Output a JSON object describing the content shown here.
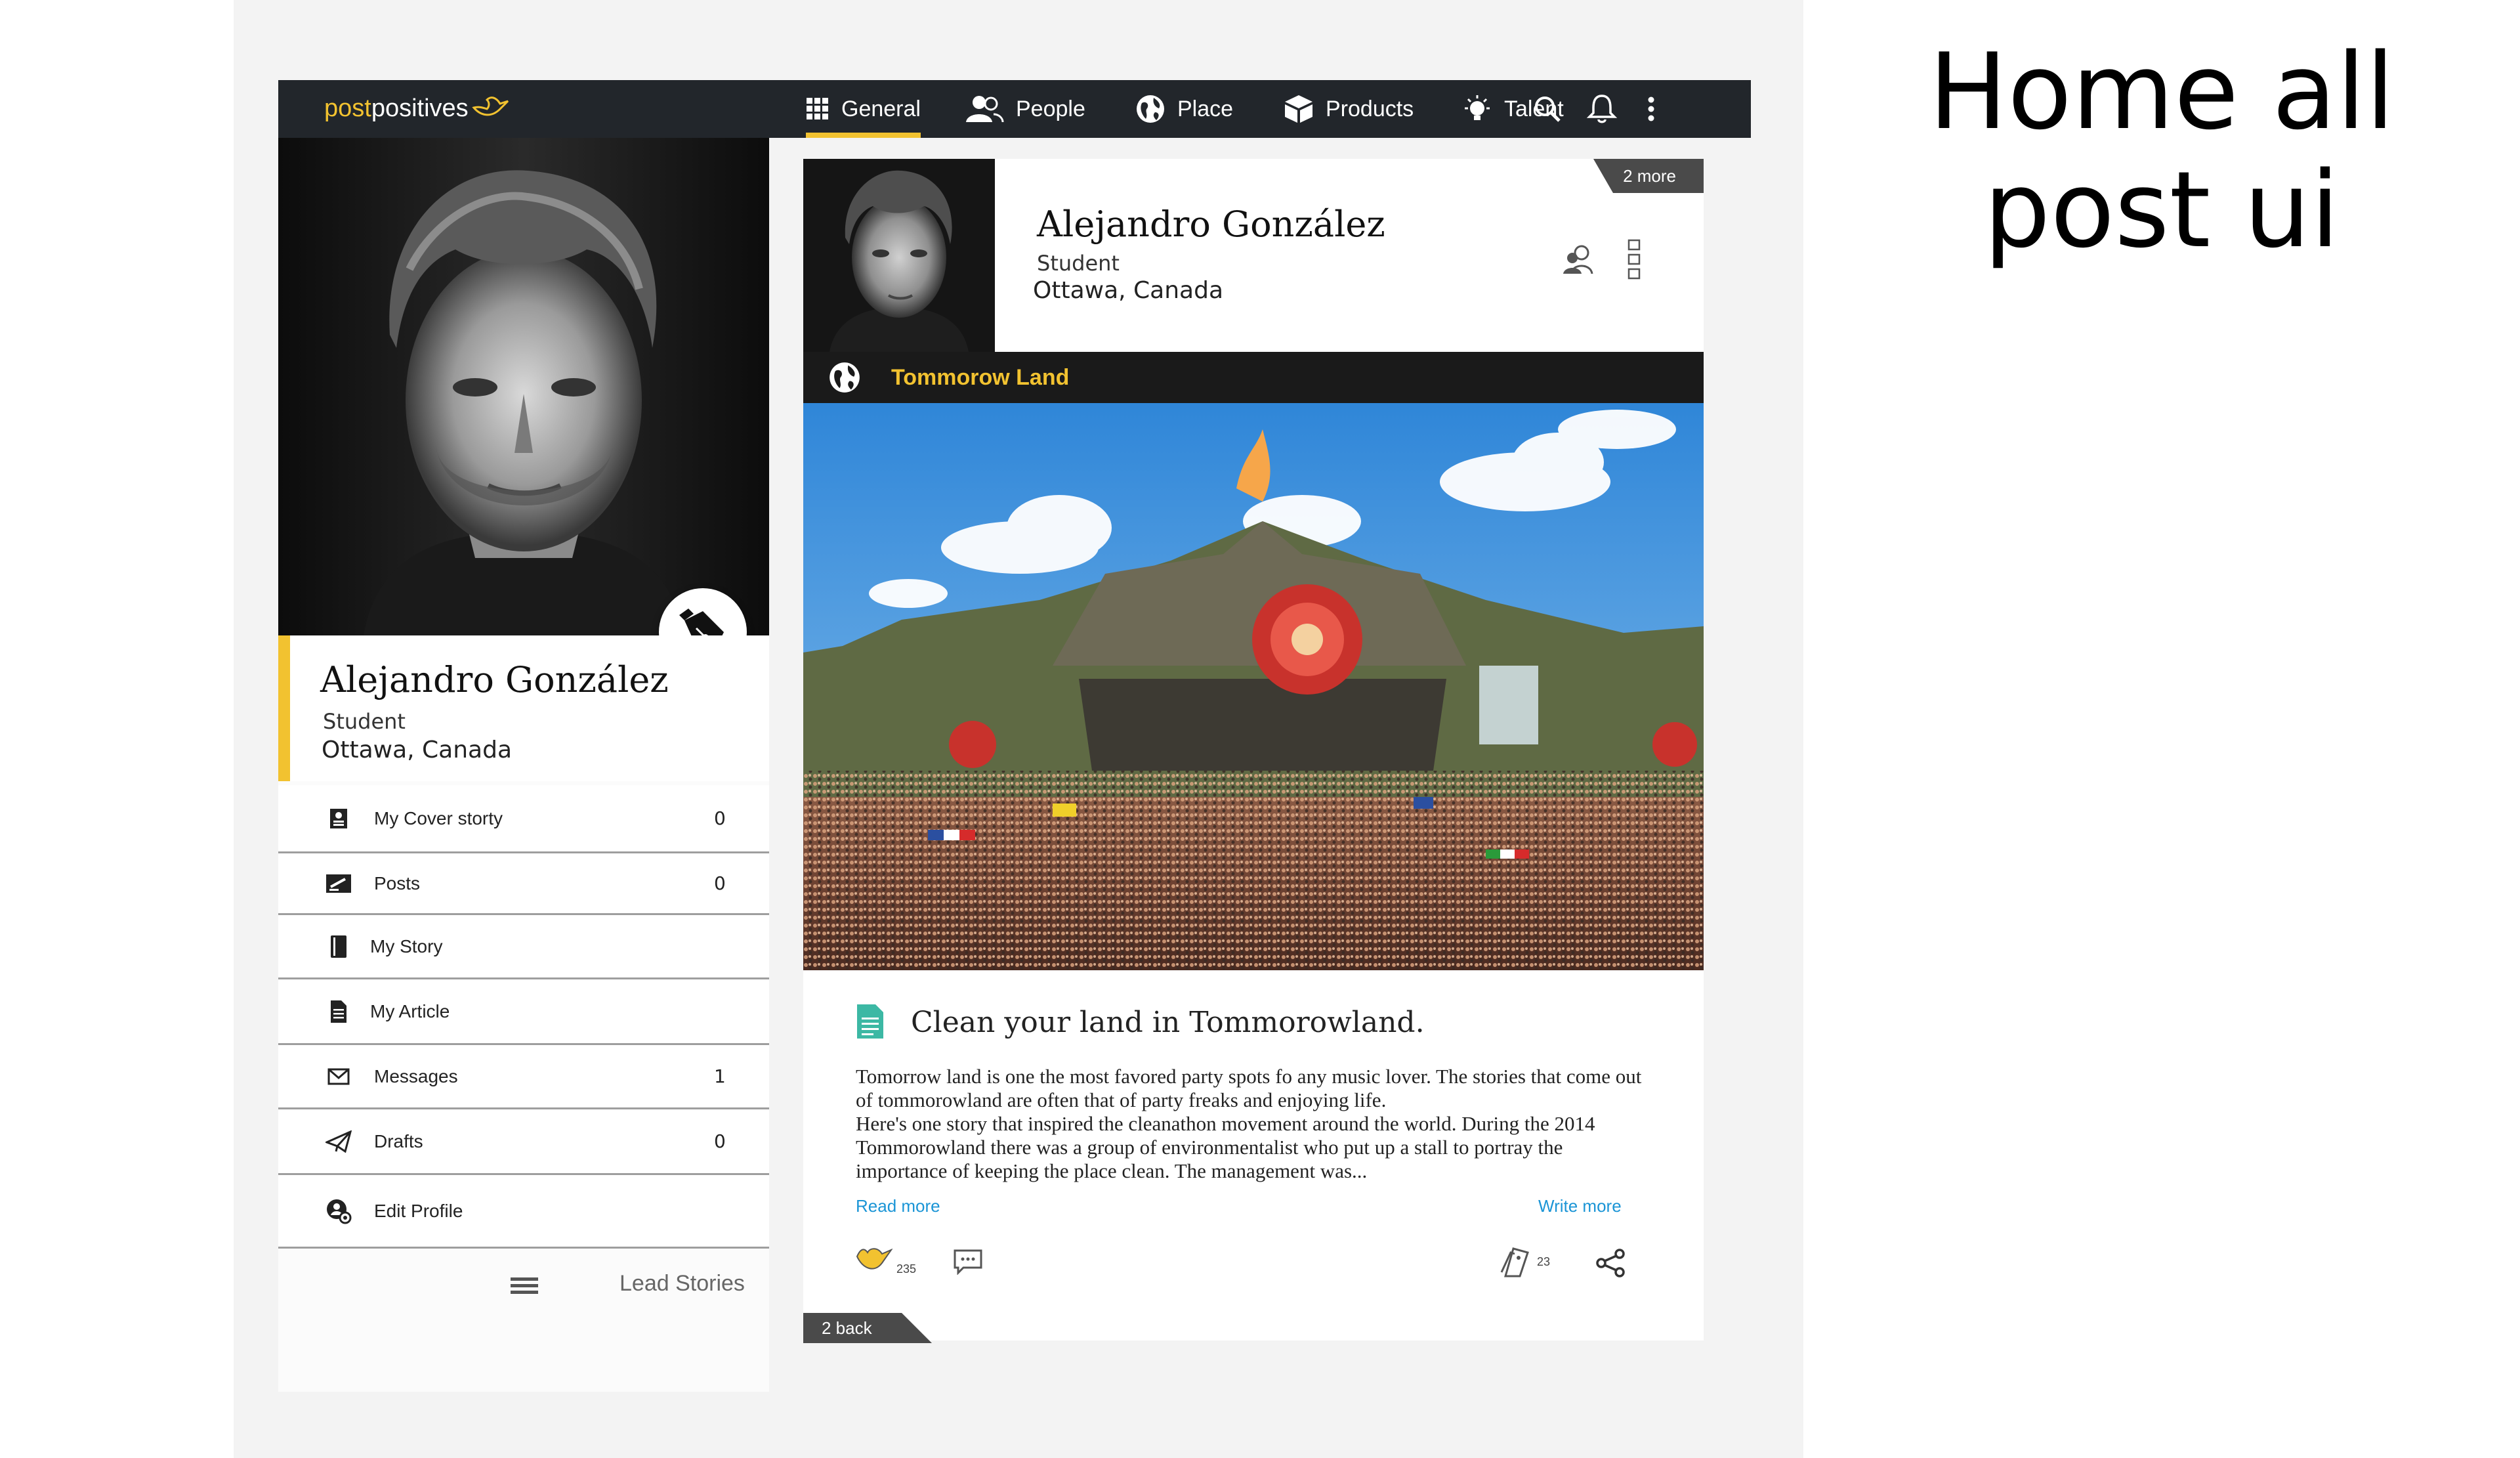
{
  "page_heading": "Home all post ui",
  "colors": {
    "accent": "#f2c230",
    "nav_bg": "#22262b",
    "link": "#1b95d6"
  },
  "logo": {
    "part1": "post",
    "part2": "positives"
  },
  "nav": {
    "items": [
      {
        "label": "General",
        "icon": "grid-icon",
        "active": true
      },
      {
        "label": "People",
        "icon": "people-icon",
        "active": false
      },
      {
        "label": "Place",
        "icon": "globe-icon",
        "active": false
      },
      {
        "label": "Products",
        "icon": "box-icon",
        "active": false
      },
      {
        "label": "Talent",
        "icon": "lightbulb-icon",
        "active": false
      }
    ],
    "right_icons": [
      "search-icon",
      "bell-icon",
      "more-vertical-icon"
    ]
  },
  "profile": {
    "name": "Alejandro González",
    "role": "Student",
    "location": "Ottawa, Canada"
  },
  "menu": [
    {
      "label": "My Cover storty",
      "count": "0",
      "icon": "cover-story-icon"
    },
    {
      "label": "Posts",
      "count": "0",
      "icon": "posts-icon"
    },
    {
      "label": "My Story",
      "count": "",
      "icon": "book-icon"
    },
    {
      "label": "My Article",
      "count": "",
      "icon": "document-icon"
    },
    {
      "label": "Messages",
      "count": "1",
      "icon": "envelope-icon"
    },
    {
      "label": "Drafts",
      "count": "0",
      "icon": "paper-plane-icon"
    },
    {
      "label": "Edit Profile",
      "count": "",
      "icon": "user-settings-icon"
    }
  ],
  "lead_stories": "Lead Stories",
  "post": {
    "more_tag": "2 more",
    "author": {
      "name": "Alejandro González",
      "role": "Student",
      "location": "Ottawa, Canada"
    },
    "place": "Tommorow Land",
    "title": "Clean your land in Tommorowland.",
    "body": "Tomorrow land is one the most favored party spots fo any music lover. The stories that come out of tommorowland are often that of party freaks and enjoying life.\nHere's one story that inspired the cleanathon movement around the world. During the 2014 Tommorowland there was a group of environmentalist who put up a stall to portray the importance of keeping the place clean. The management was...",
    "read_more": "Read more",
    "write_more": "Write more",
    "likes": "235",
    "reposts": "23",
    "back_tag": "2 back"
  }
}
